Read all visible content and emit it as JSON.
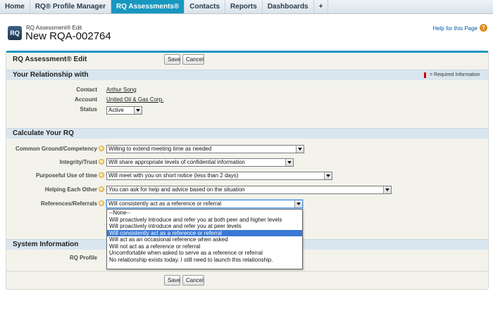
{
  "tabs": [
    {
      "label": "Home"
    },
    {
      "label": "RQ® Profile Manager"
    },
    {
      "label": "RQ Assessments®"
    },
    {
      "label": "Contacts"
    },
    {
      "label": "Reports"
    },
    {
      "label": "Dashboards"
    },
    {
      "label": "+"
    }
  ],
  "active_tab": "RQ Assessments®",
  "header": {
    "icon_text": "RQ",
    "subtitle": "RQ Assessment® Edit",
    "title": "New RQA-002764",
    "help_link": "Help for this Page",
    "help_icon": "?"
  },
  "form": {
    "title": "RQ Assessment® Edit",
    "save_label": "Save",
    "cancel_label": "Cancel",
    "required_info": "= Required Information"
  },
  "relationship": {
    "section_title": "Your Relationship with",
    "contact_label": "Contact",
    "contact_value": "Arthur Song",
    "account_label": "Account",
    "account_value": "United Oil & Gas Corp.",
    "status_label": "Status",
    "status_value": "Active"
  },
  "rq": {
    "section_title": "Calculate Your RQ",
    "fields": [
      {
        "label": "Common Ground/Competency",
        "value": "Willing to extend meeting time as needed"
      },
      {
        "label": "Integrity/Trust",
        "value": "Will share appropriate levels of confidential information"
      },
      {
        "label": "Purposeful Use of time",
        "value": "Will meet with you on short notice (less than 2 days)"
      },
      {
        "label": "Helping Each Other",
        "value": "You can ask for help and advice based on the situation"
      },
      {
        "label": "References/Referrals",
        "value": "Will consistently act as a reference or referral"
      }
    ]
  },
  "referral_options": [
    "--None--",
    "Will proactively introduce and refer you at both peer and higher levels",
    "Will proactively introduce and refer you at peer levels",
    "Will consistently act as a reference or referral",
    "Will act as an occasional reference when asked",
    "Will not act as a reference or referral",
    "Uncomfortable when asked to serve as a reference or referral",
    "No relationship exists today. I still need to launch this relationship."
  ],
  "referral_highlighted_index": 3,
  "system": {
    "section_title": "System Information",
    "rq_profile_label": "RQ Profile"
  },
  "colors": {
    "accent": "#1797c0",
    "highlight": "#3a78d4",
    "required": "#cc0000"
  }
}
